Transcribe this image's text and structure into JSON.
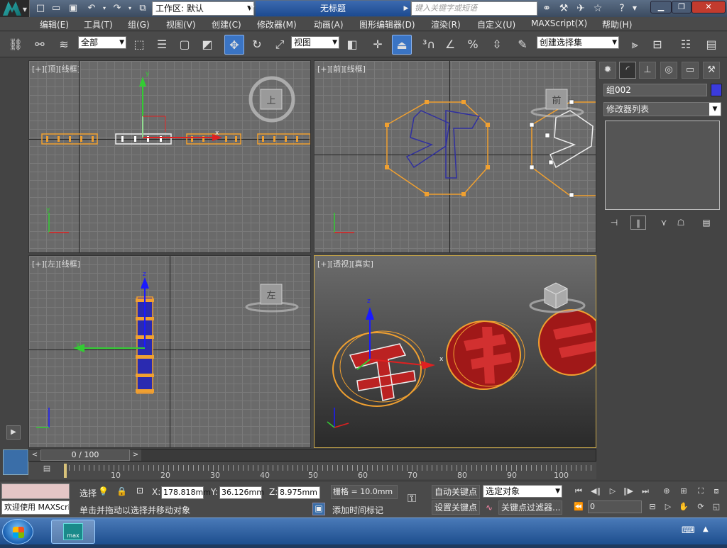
{
  "titlebar": {
    "workspace_label": "工作区: 默认",
    "doc_title": "无标题",
    "search_placeholder": "键入关键字或短语"
  },
  "menu": [
    "编辑(E)",
    "工具(T)",
    "组(G)",
    "视图(V)",
    "创建(C)",
    "修改器(M)",
    "动画(A)",
    "图形编辑器(D)",
    "渲染(R)",
    "自定义(U)",
    "MAXScript(X)",
    "帮助(H)"
  ],
  "toolbar": {
    "filter_value": "全部",
    "coord_system": "视图",
    "selection_set_placeholder": "创建选择集"
  },
  "viewports": {
    "top": {
      "label": "[+][顶][线框]",
      "cube_label": "上"
    },
    "front": {
      "label": "[+][前][线框]",
      "cube_label": "前"
    },
    "left": {
      "label": "[+][左][线框]",
      "cube_label": "左"
    },
    "perspective": {
      "label": "[+][透视][真实]"
    }
  },
  "command_panel": {
    "object_name": "组002",
    "object_color": "#3b3bdc",
    "modifier_list": "修改器列表"
  },
  "timeline": {
    "frame_display": "0 / 100",
    "ticks": [
      "10",
      "20",
      "30",
      "40",
      "50",
      "60",
      "70",
      "80",
      "90",
      "100"
    ]
  },
  "statusbar": {
    "welcome": "欢迎使用 MAXScri",
    "selection_label": "选择",
    "prompt": "单击并拖动以选择并移动对象",
    "x_label": "X:",
    "x_value": "178.818mm",
    "y_label": "Y:",
    "y_value": "36.126mm",
    "z_label": "Z:",
    "z_value": "8.975mm",
    "grid": "栅格 = 10.0mm",
    "add_time_tag": "添加时间标记",
    "auto_key": "自动关键点",
    "set_key": "设置关键点",
    "selected_object": "选定对象",
    "key_filters": "关键点过滤器...",
    "current_frame": "0"
  },
  "taskbar": {
    "app_label": "max"
  }
}
